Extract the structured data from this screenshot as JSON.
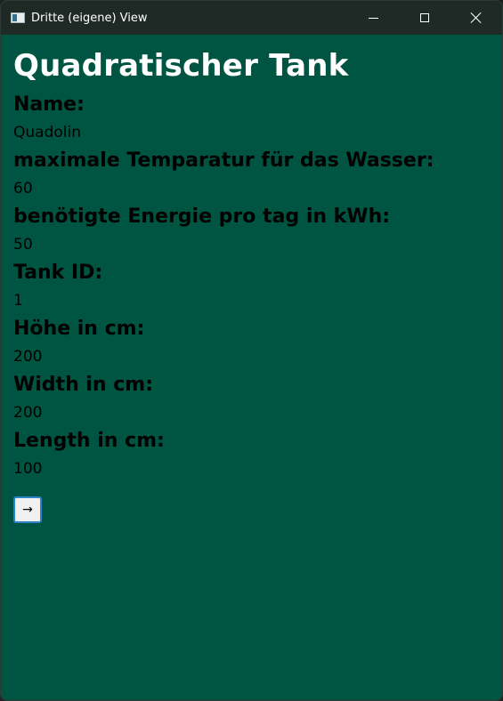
{
  "window": {
    "title": "Dritte (eigene) View"
  },
  "page": {
    "title": "Quadratischer Tank"
  },
  "fields": [
    {
      "label": "Name:",
      "value": "Quadolin"
    },
    {
      "label": "maximale Temparatur für das Wasser:",
      "value": "60"
    },
    {
      "label": "benötigte Energie pro tag in kWh:",
      "value": "50"
    },
    {
      "label": "Tank ID:",
      "value": "1"
    },
    {
      "label": "Höhe in cm:",
      "value": "200"
    },
    {
      "label": "Width in cm:",
      "value": "200"
    },
    {
      "label": "Length in cm:",
      "value": "100"
    }
  ],
  "actions": {
    "next_label": "→"
  },
  "colors": {
    "background": "#005542",
    "titlebar": "#1f2a27",
    "title_text": "#ffffff",
    "button_border": "#2b84c7"
  },
  "icons": {
    "app": "app-window-icon",
    "minimize": "minimize-icon",
    "maximize": "maximize-icon",
    "close": "close-icon"
  }
}
